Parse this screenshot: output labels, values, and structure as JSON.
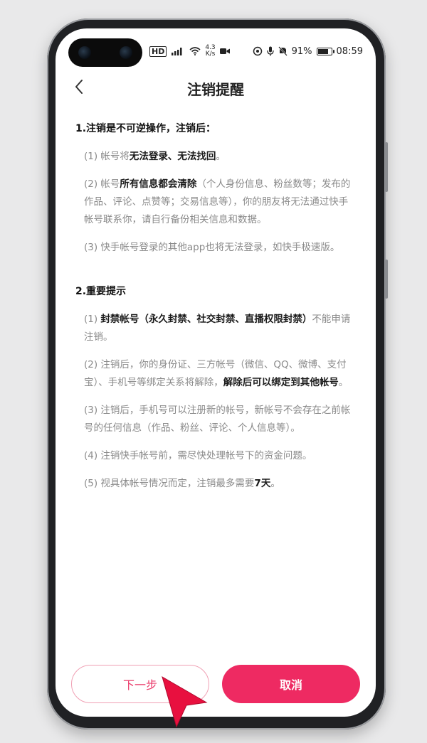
{
  "status": {
    "net_type": "HD",
    "speed_value": "4.3",
    "speed_unit": "K/s",
    "battery_percent": "91%",
    "battery_level": 0.91,
    "time": "08:59"
  },
  "header": {
    "title": "注销提醒"
  },
  "section1": {
    "title": "1.注销是不可逆操作，注销后：",
    "items": [
      {
        "pre": "(1) 帐号将",
        "bold": "无法登录、无法找回",
        "post": "。"
      },
      {
        "pre": "(2) 帐号",
        "bold": "所有信息都会清除",
        "post": "（个人身份信息、粉丝数等；发布的作品、评论、点赞等；交易信息等），你的朋友将无法通过快手帐号联系你，请自行备份相关信息和数据。"
      },
      {
        "text": "(3) 快手帐号登录的其他app也将无法登录，如快手极速版。"
      }
    ]
  },
  "section2": {
    "title": "2.重要提示",
    "items": [
      {
        "pre": "(1) ",
        "bold": "封禁帐号（永久封禁、社交封禁、直播权限封禁）",
        "post": "不能申请注销。"
      },
      {
        "pre": "(2) 注销后，你的身份证、三方帐号（微信、QQ、微博、支付宝）、手机号等绑定关系将解除，",
        "bold": "解除后可以绑定到其他帐号",
        "post": "。"
      },
      {
        "text": "(3) 注销后，手机号可以注册新的帐号，新帐号不会存在之前帐号的任何信息（作品、粉丝、评论、个人信息等）。"
      },
      {
        "text": "(4) 注销快手帐号前，需尽快处理帐号下的资金问题。"
      },
      {
        "pre": "(5) 视具体帐号情况而定，注销最多需要",
        "bold": "7天",
        "post": "。"
      }
    ]
  },
  "buttons": {
    "next_label": "下一步",
    "cancel_label": "取消"
  },
  "colors": {
    "accent": "#ee2a62",
    "accent_outline": "#f0a0b4",
    "cursor": "#e8103f"
  },
  "icons": {
    "back": "chevron-left-icon",
    "cursor": "arrow-pointer-icon"
  }
}
